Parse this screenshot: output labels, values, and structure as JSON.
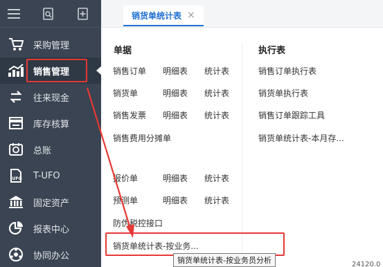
{
  "sidebar": {
    "top_icons": [
      "menu-icon",
      "search-doc-icon",
      "add-doc-icon"
    ],
    "items": [
      {
        "label": "采购管理",
        "icon": "cart-icon"
      },
      {
        "label": "销售管理",
        "icon": "sales-chart-icon"
      },
      {
        "label": "往来现金",
        "icon": "exchange-icon"
      },
      {
        "label": "库存核算",
        "icon": "warehouse-icon"
      },
      {
        "label": "总账",
        "icon": "ledger-icon"
      },
      {
        "label": "T-UFO",
        "icon": "ufo-icon"
      },
      {
        "label": "固定资产",
        "icon": "bank-icon"
      },
      {
        "label": "报表中心",
        "icon": "pie-chart-icon"
      },
      {
        "label": "协同办公",
        "icon": "collab-icon"
      }
    ]
  },
  "tabbar": {
    "active_tab": "销货单统计表",
    "close_symbol": "×"
  },
  "menu": {
    "documents": {
      "title": "单据",
      "rows": [
        [
          "销售订单",
          "明细表",
          "统计表"
        ],
        [
          "销货单",
          "明细表",
          "统计表"
        ],
        [
          "销售发票",
          "明细表",
          "统计表"
        ],
        [
          "销售费用分摊单"
        ],
        [
          "报价单",
          "明细表",
          "统计表"
        ],
        [
          "预测单",
          "明细表",
          "统计表"
        ],
        [
          "防伪税控接口"
        ],
        [
          "销货单统计表-按业务..."
        ]
      ]
    },
    "execution": {
      "title": "执行表",
      "items": [
        "销售订单执行表",
        "销货单执行表",
        "销售订单跟踪工具",
        "销货单统计表-本月存..."
      ]
    }
  },
  "tooltip": "销货单统计表-按业务员分析",
  "partial_text": "24120.0",
  "colors": {
    "highlight": "#e53935",
    "sidebar_bg": "#3a4452",
    "accent": "#1f6fd1"
  }
}
